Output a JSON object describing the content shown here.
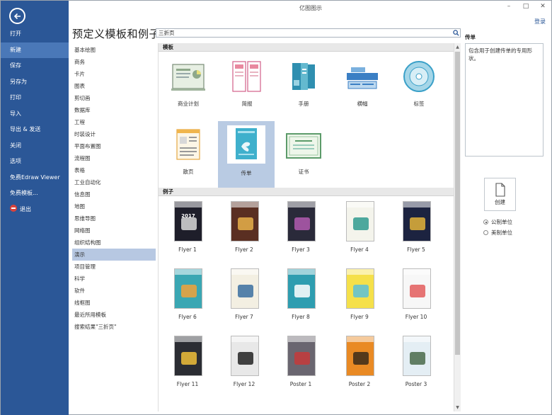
{
  "window": {
    "title": "亿图图示",
    "login": "登录"
  },
  "nav": {
    "items": [
      "打开",
      "新建",
      "保存",
      "另存为",
      "打印",
      "导入",
      "导出 & 发送",
      "关闭",
      "选项",
      "免费Edraw Viewer",
      "免费模板...",
      "退出"
    ],
    "active_index": 1
  },
  "header": {
    "title": "预定义模板和例子"
  },
  "search": {
    "value": "三折页"
  },
  "categories": {
    "items": [
      "基本绘图",
      "商务",
      "卡片",
      "图表",
      "剪切画",
      "数据库",
      "工程",
      "时装设计",
      "平面布置图",
      "流程图",
      "表格",
      "工业自动化",
      "信息图",
      "地图",
      "思维导图",
      "网络图",
      "组织结构图",
      "演示",
      "项目管理",
      "科学",
      "软件",
      "线框图",
      "最近所用模板",
      "搜索结果\"三折页\""
    ],
    "active_index": 17
  },
  "templates": {
    "header": "模板",
    "items": [
      {
        "label": "商业计划",
        "icon": "business-plan-icon"
      },
      {
        "label": "简报",
        "icon": "newsletter-icon"
      },
      {
        "label": "手册",
        "icon": "brochure-icon"
      },
      {
        "label": "横幅",
        "icon": "banner-icon"
      },
      {
        "label": "标签",
        "icon": "cd-label-icon"
      },
      {
        "label": "散页",
        "icon": "leaflet-icon"
      },
      {
        "label": "传单",
        "icon": "flyer-icon"
      },
      {
        "label": "证书",
        "icon": "certificate-icon"
      }
    ],
    "selected_index": 6
  },
  "examples": {
    "header": "例子",
    "items": [
      {
        "label": "Flyer 1",
        "bg": "#1e1e2a",
        "accent": "#d9d9d9",
        "text": "2017"
      },
      {
        "label": "Flyer 2",
        "bg": "#5a2f22",
        "accent": "#e7b04a",
        "text": ""
      },
      {
        "label": "Flyer 3",
        "bg": "#2a2a3a",
        "accent": "#b25ab0",
        "text": ""
      },
      {
        "label": "Flyer 4",
        "bg": "#f4f4ec",
        "accent": "#2f9a8f",
        "text": ""
      },
      {
        "label": "Flyer 5",
        "bg": "#1c2340",
        "accent": "#e3b33a",
        "text": ""
      },
      {
        "label": "Flyer 6",
        "bg": "#3aa7b3",
        "accent": "#f2a23a",
        "text": ""
      },
      {
        "label": "Flyer 7",
        "bg": "#f3efe2",
        "accent": "#3a6ea0",
        "text": ""
      },
      {
        "label": "Flyer 8",
        "bg": "#2e9db0",
        "accent": "#ffffff",
        "text": ""
      },
      {
        "label": "Flyer 9",
        "bg": "#f5e04a",
        "accent": "#5cc0d8",
        "text": ""
      },
      {
        "label": "Flyer 10",
        "bg": "#f7f7f7",
        "accent": "#e35d5d",
        "text": ""
      },
      {
        "label": "Flyer 11",
        "bg": "#2b2d33",
        "accent": "#f0c03a",
        "text": ""
      },
      {
        "label": "Flyer 12",
        "bg": "#e8e8e8",
        "accent": "#222222",
        "text": ""
      },
      {
        "label": "Poster 1",
        "bg": "#6a6670",
        "accent": "#c43a3a",
        "text": ""
      },
      {
        "label": "Poster 2",
        "bg": "#e98a24",
        "accent": "#3a2a1a",
        "text": ""
      },
      {
        "label": "Poster 3",
        "bg": "#e4eef4",
        "accent": "#4a6a4a",
        "text": ""
      }
    ]
  },
  "description": {
    "title": "传单",
    "text": "包含用于创建传单的专用形状。"
  },
  "create": {
    "label": "创建"
  },
  "units": {
    "options": [
      "公制单位",
      "美制单位"
    ],
    "selected_index": 0
  }
}
